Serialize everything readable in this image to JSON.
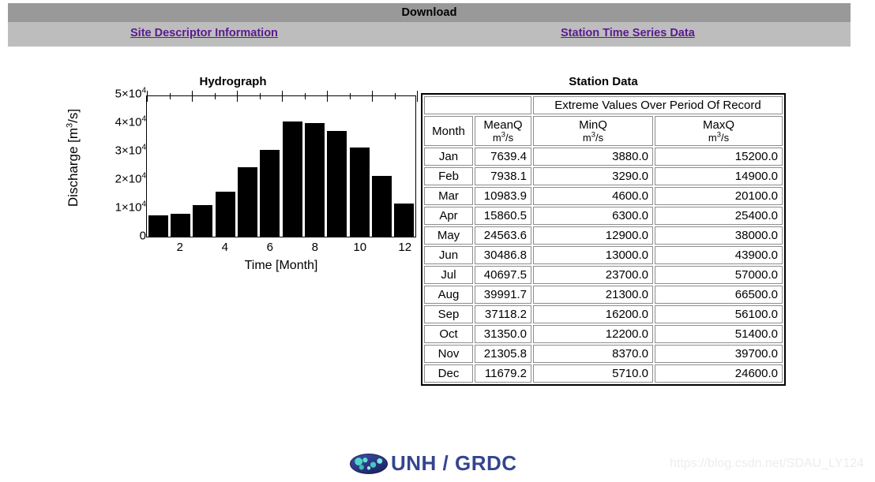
{
  "header": {
    "title": "Download",
    "links": [
      {
        "id": "site-descriptor",
        "label": "Site Descriptor Information"
      },
      {
        "id": "station-series",
        "label": "Station Time Series Data"
      }
    ],
    "title_band_color": "#999999",
    "link_band_color": "#bdbdbd",
    "link_color": "#5a1a90"
  },
  "hydrograph": {
    "title": "Hydrograph",
    "ylabel_prefix": "Discharge [m",
    "ylabel_sup": "3",
    "ylabel_suffix": "/s]",
    "xlabel": "Time [Month]",
    "y_ticks": [
      {
        "mantissa": "5×10",
        "exp": "4",
        "value": 50000
      },
      {
        "mantissa": "4×10",
        "exp": "4",
        "value": 40000
      },
      {
        "mantissa": "3×10",
        "exp": "4",
        "value": 30000
      },
      {
        "mantissa": "2×10",
        "exp": "4",
        "value": 20000
      },
      {
        "mantissa": "1×10",
        "exp": "4",
        "value": 10000
      },
      {
        "mantissa": "0",
        "exp": "",
        "value": 0
      }
    ],
    "x_ticks": [
      "2",
      "4",
      "6",
      "8",
      "10",
      "12"
    ],
    "bar_color": "#000000"
  },
  "chart_data": {
    "type": "bar",
    "title": "Hydrograph",
    "xlabel": "Time [Month]",
    "ylabel": "Discharge [m3/s]",
    "categories": [
      1,
      2,
      3,
      4,
      5,
      6,
      7,
      8,
      9,
      10,
      11,
      12
    ],
    "category_labels": [
      "Jan",
      "Feb",
      "Mar",
      "Apr",
      "May",
      "Jun",
      "Jul",
      "Aug",
      "Sep",
      "Oct",
      "Nov",
      "Dec"
    ],
    "values": [
      7639.4,
      7938.1,
      10983.9,
      15860.5,
      24563.6,
      30486.8,
      40697.5,
      39991.7,
      37118.2,
      31350.0,
      21305.8,
      11679.2
    ],
    "series": [
      {
        "name": "MeanQ",
        "values": [
          7639.4,
          7938.1,
          10983.9,
          15860.5,
          24563.6,
          30486.8,
          40697.5,
          39991.7,
          37118.2,
          31350.0,
          21305.8,
          11679.2
        ]
      }
    ],
    "ylim": [
      0,
      50000
    ],
    "xlim": [
      0.5,
      12.5
    ],
    "ytick_values": [
      0,
      10000,
      20000,
      30000,
      40000,
      50000
    ],
    "xtick_values": [
      2,
      4,
      6,
      8,
      10,
      12
    ],
    "grid": false,
    "legend": null
  },
  "station": {
    "title": "Station Data",
    "group_header": "Extreme Values Over Period Of Record",
    "columns": [
      {
        "key": "month",
        "label": "Month",
        "unit": ""
      },
      {
        "key": "meanq",
        "label": "MeanQ",
        "unit_prefix": "m",
        "unit_sup": "3",
        "unit_suffix": "/s"
      },
      {
        "key": "minq",
        "label": "MinQ",
        "unit_prefix": "m",
        "unit_sup": "3",
        "unit_suffix": "/s"
      },
      {
        "key": "maxq",
        "label": "MaxQ",
        "unit_prefix": "m",
        "unit_sup": "3",
        "unit_suffix": "/s"
      }
    ],
    "rows": [
      {
        "month": "Jan",
        "meanq": "7639.4",
        "minq": "3880.0",
        "maxq": "15200.0"
      },
      {
        "month": "Feb",
        "meanq": "7938.1",
        "minq": "3290.0",
        "maxq": "14900.0"
      },
      {
        "month": "Mar",
        "meanq": "10983.9",
        "minq": "4600.0",
        "maxq": "20100.0"
      },
      {
        "month": "Apr",
        "meanq": "15860.5",
        "minq": "6300.0",
        "maxq": "25400.0"
      },
      {
        "month": "May",
        "meanq": "24563.6",
        "minq": "12900.0",
        "maxq": "38000.0"
      },
      {
        "month": "Jun",
        "meanq": "30486.8",
        "minq": "13000.0",
        "maxq": "43900.0"
      },
      {
        "month": "Jul",
        "meanq": "40697.5",
        "minq": "23700.0",
        "maxq": "57000.0"
      },
      {
        "month": "Aug",
        "meanq": "39991.7",
        "minq": "21300.0",
        "maxq": "66500.0"
      },
      {
        "month": "Sep",
        "meanq": "37118.2",
        "minq": "16200.0",
        "maxq": "56100.0"
      },
      {
        "month": "Oct",
        "meanq": "31350.0",
        "minq": "12200.0",
        "maxq": "51400.0"
      },
      {
        "month": "Nov",
        "meanq": "21305.8",
        "minq": "8370.0",
        "maxq": "39700.0"
      },
      {
        "month": "Dec",
        "meanq": "11679.2",
        "minq": "5710.0",
        "maxq": "24600.0"
      }
    ]
  },
  "footer": {
    "brand": "UNH / GRDC",
    "logo_icon": "globe-icon",
    "watermark": "https://blog.csdn.net/SDAU_LY124",
    "brand_color": "#33458f"
  }
}
